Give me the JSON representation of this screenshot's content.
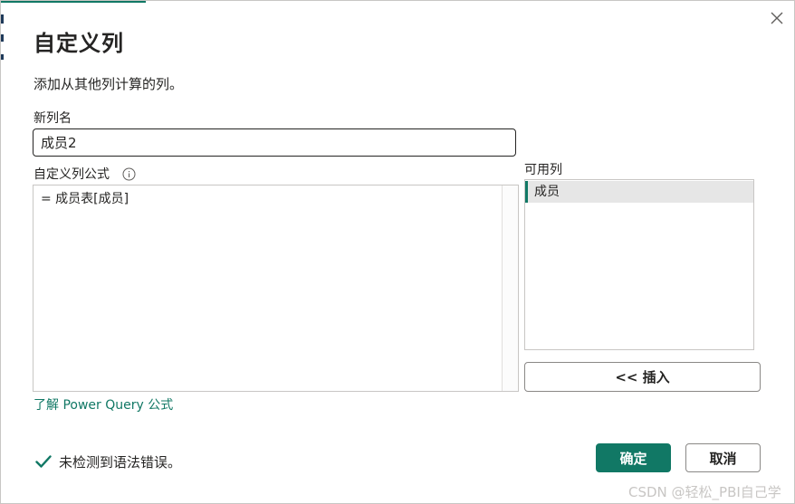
{
  "dialog": {
    "title": "自定义列",
    "subtitle": "添加从其他列计算的列。",
    "close_icon": "close-icon"
  },
  "new_column": {
    "label": "新列名",
    "value": "成员2"
  },
  "formula": {
    "label": "自定义列公式",
    "info_icon": "info-icon",
    "text": "= 成员表[成员]"
  },
  "available_columns": {
    "label": "可用列",
    "items": [
      {
        "label": "成员"
      }
    ]
  },
  "insert_button": {
    "label": "<< 插入"
  },
  "learn_link": {
    "label": "了解 Power Query 公式"
  },
  "status": {
    "icon": "checkmark-icon",
    "text": "未检测到语法错误。"
  },
  "buttons": {
    "ok_label": "确定",
    "cancel_label": "取消"
  },
  "watermark": "CSDN @轻松_PBI自己学",
  "colors": {
    "accent": "#117865",
    "text": "#252423",
    "border": "#c8c6c4"
  }
}
